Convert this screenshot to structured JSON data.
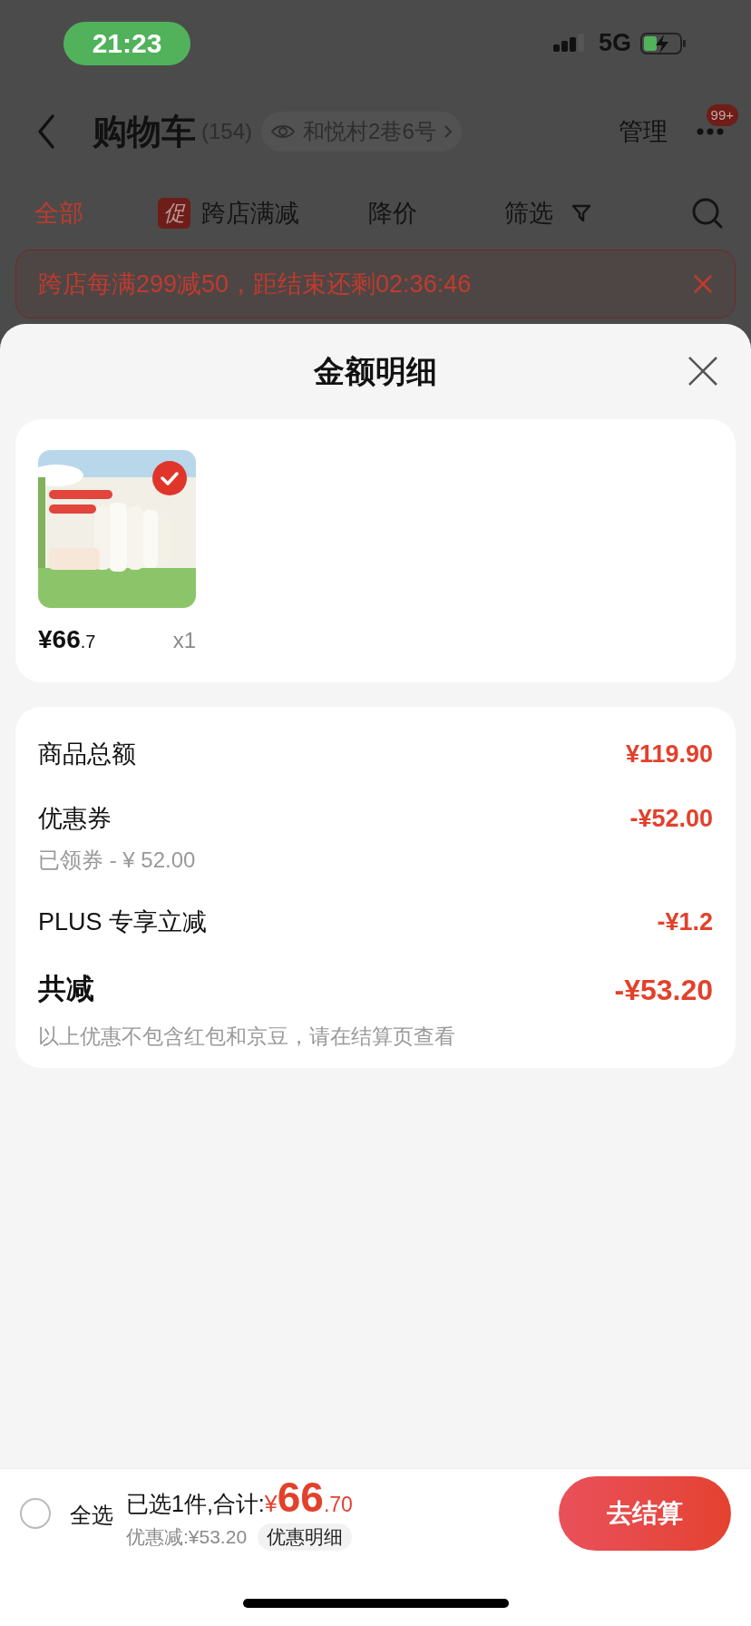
{
  "status_bar": {
    "time": "21:23",
    "network": "5G"
  },
  "header": {
    "title": "购物车",
    "count": "(154)",
    "address": "和悦村2巷6号",
    "manage": "管理",
    "badge": "99+"
  },
  "filter_tabs": [
    {
      "label": "全部",
      "selected": true,
      "kind": "plain"
    },
    {
      "label": "跨店满减",
      "selected": false,
      "kind": "promo",
      "badge": "促"
    },
    {
      "label": "降价",
      "selected": false,
      "kind": "plain"
    },
    {
      "label": "筛选",
      "selected": false,
      "kind": "filter"
    }
  ],
  "promo_banner": {
    "text": "跨店每满299减50，距结束还剩02:36:46"
  },
  "sheet": {
    "title": "金额明细",
    "products": [
      {
        "price": "¥66",
        "price_decimal": ".7",
        "quantity": "x1",
        "selected": true
      }
    ],
    "summary": {
      "rows": [
        {
          "kind": "amount",
          "label": "商品总额",
          "value": "¥119.90"
        },
        {
          "kind": "amount",
          "label": "优惠券",
          "value": "-¥52.00",
          "sub": "已领券 - ¥ 52.00"
        },
        {
          "kind": "amount",
          "label": "PLUS 专享立减",
          "value": "-¥1.2"
        },
        {
          "kind": "total",
          "label": "共减",
          "value": "-¥53.20"
        }
      ],
      "note": "以上优惠不包含红包和京豆，请在结算页查看"
    }
  },
  "bottom_bar": {
    "select_all": {
      "label": "全选",
      "checked": false
    },
    "selected_text": "已选1件,合计:",
    "currency": "¥",
    "total": "66",
    "total_decimal": ".70",
    "discount": "优惠减:¥53.20",
    "detail_button": "优惠明细",
    "checkout": "去结算"
  }
}
